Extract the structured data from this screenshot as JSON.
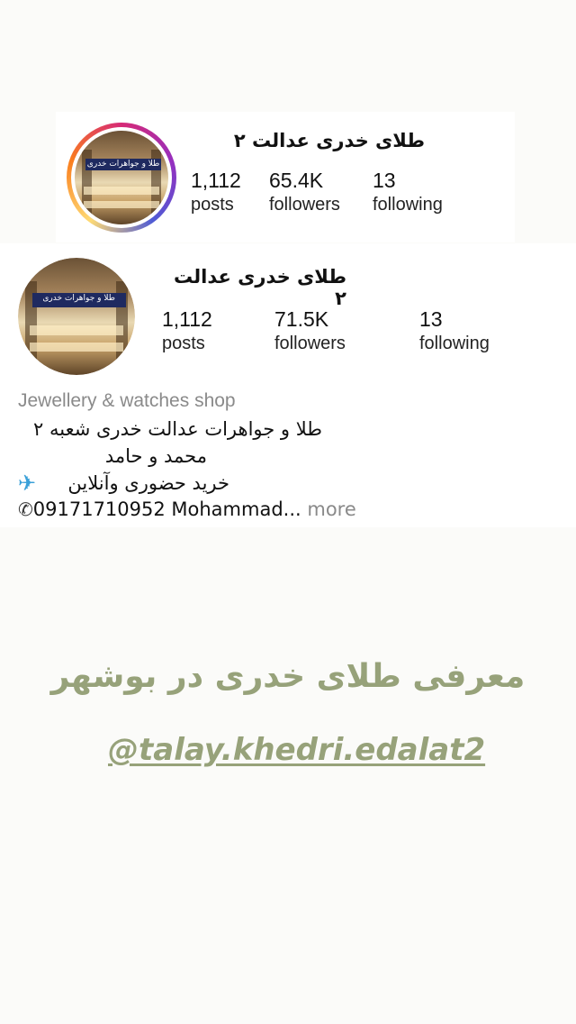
{
  "profile_old": {
    "name": "طلای خدری عدالت ۲",
    "avatar_sign": "طلا و جواهرات خدری",
    "stats": [
      {
        "num": "1,112",
        "label": "posts"
      },
      {
        "num": "65.4K",
        "label": "followers"
      },
      {
        "num": "13",
        "label": "following"
      }
    ]
  },
  "profile": {
    "name": "طلای خدری عدالت ۲",
    "avatar_sign": "طلا و جواهرات خدری",
    "stats": [
      {
        "num": "1,112",
        "label": "posts"
      },
      {
        "num": "71.5K",
        "label": "followers"
      },
      {
        "num": "13",
        "label": "following"
      }
    ],
    "category": "Jewellery & watches shop",
    "bio": {
      "line1": "طلا و جواهرات عدالت خدری شعبه ۲",
      "line2": "محمد و حامد",
      "line3": "خرید حضوری وآنلاین",
      "line3_icon": "airplane-icon",
      "line4_icon": "phone-icon",
      "line4": "09171710952 Mohammad...",
      "more": " more"
    }
  },
  "promo": {
    "title": "معرفی طلای خدری در بوشهر",
    "handle": "@talay.khedri.edalat2"
  },
  "colors": {
    "promo_text": "#97a27a",
    "category_text": "#8a8a8a"
  }
}
